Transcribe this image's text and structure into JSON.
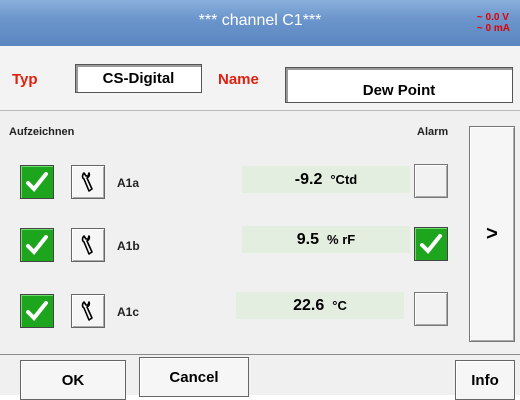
{
  "window": {
    "title": "*** channel C1***",
    "readout_voltage": "~ 0.0 V",
    "readout_current": "~ 0 mA"
  },
  "config": {
    "type_label": "Typ",
    "type_value": "CS-Digital",
    "name_label": "Name",
    "name_value": "Dew Point"
  },
  "table": {
    "record_header": "Aufzeichnen",
    "alarm_header": "Alarm",
    "rows": [
      {
        "name": "A1a",
        "value": "-9.2",
        "unit": "°Ctd",
        "record_checked": true,
        "alarm_checked": false
      },
      {
        "name": "A1b",
        "value": "9.5",
        "unit": "% rF",
        "record_checked": true,
        "alarm_checked": true
      },
      {
        "name": "A1c",
        "value": "22.6",
        "unit": "°C",
        "record_checked": true,
        "alarm_checked": false
      }
    ]
  },
  "buttons": {
    "next": ">",
    "ok": "OK",
    "cancel": "Cancel",
    "info": "Info"
  },
  "colors": {
    "title_bar": "#6c96cc",
    "label_red": "#e02010",
    "check_green": "#1ea51e",
    "value_bg": "#e4eee0"
  },
  "icons": {
    "tool": "wrench-icon",
    "check": "checkmark-icon"
  }
}
